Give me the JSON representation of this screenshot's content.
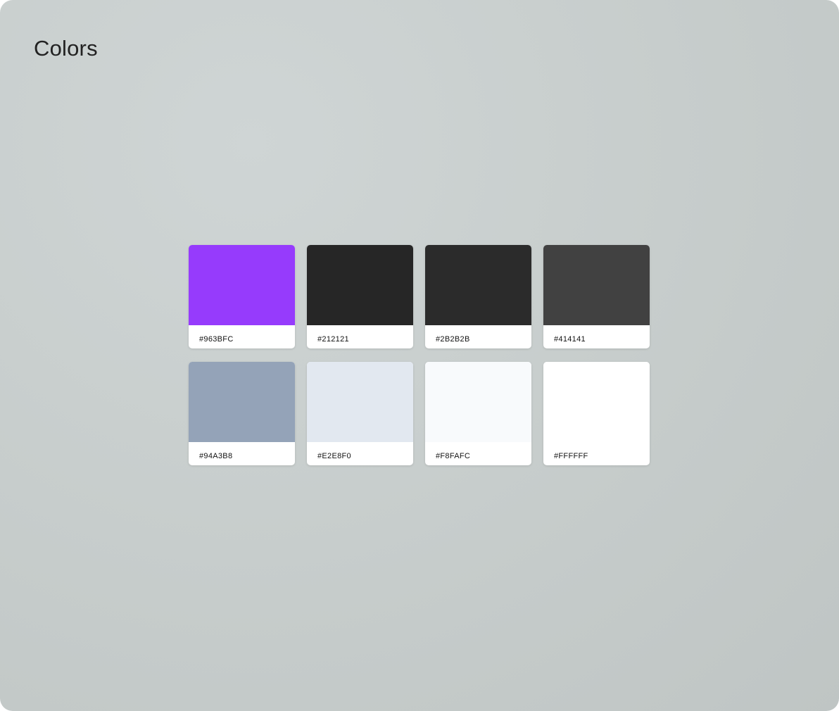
{
  "page": {
    "title": "Colors"
  },
  "swatches": [
    {
      "hex": "#963BFC",
      "color": "#963BFC"
    },
    {
      "hex": "#212121",
      "color": "#262626"
    },
    {
      "hex": "#2B2B2B",
      "color": "#2B2B2B"
    },
    {
      "hex": "#414141",
      "color": "#414141"
    },
    {
      "hex": "#94A3B8",
      "color": "#94A3B8"
    },
    {
      "hex": "#E2E8F0",
      "color": "#E2E8F0"
    },
    {
      "hex": "#F8FAFC",
      "color": "#F8FAFC"
    },
    {
      "hex": "#FFFFFF",
      "color": "#FFFFFF"
    }
  ]
}
